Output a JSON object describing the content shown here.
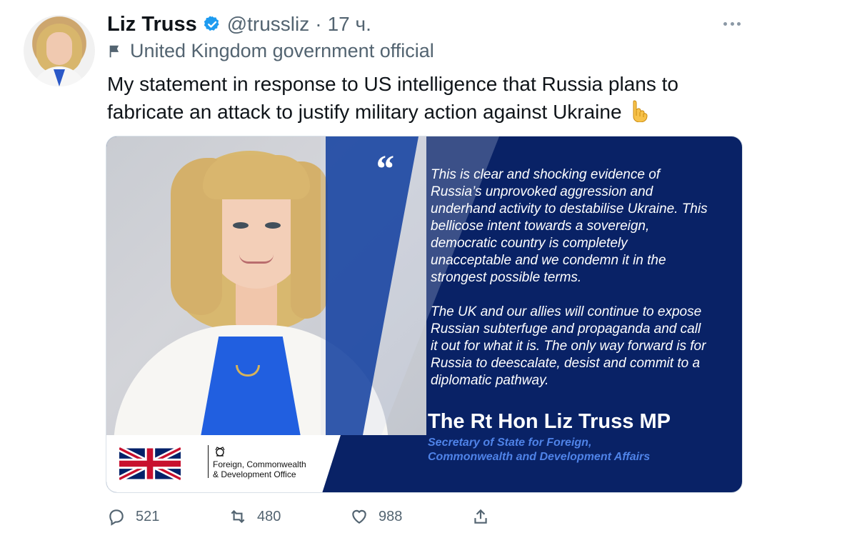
{
  "tweet": {
    "author_name": "Liz Truss",
    "handle": "@trussliz",
    "dot": "·",
    "time": "17 ч.",
    "label": "United Kingdom government official",
    "text_line_1": "My statement in response to US intelligence that Russia plans to",
    "text_line_2": "fabricate an attack to justify military action against Ukraine"
  },
  "media": {
    "quote_mark": "“",
    "quote_lines_1": [
      "This is clear and shocking evidence of",
      "Russia’s unprovoked aggression and",
      "underhand activity to destabilise Ukraine. This",
      "bellicose intent towards a sovereign,",
      "democratic country is completely",
      "unacceptable and we condemn it in the",
      "strongest possible terms."
    ],
    "quote_lines_2": [
      "The UK and our allies will continue to expose",
      "Russian subterfuge and propaganda and call",
      "it out for what it is. The only way forward is for",
      "Russia to deescalate, desist and commit to a",
      "diplomatic pathway."
    ],
    "signature_name": "The Rt Hon Liz Truss MP",
    "signature_title_1": "Secretary of State for Foreign,",
    "signature_title_2": "Commonwealth and Development Affairs",
    "fcdo_line_1": "Foreign, Commonwealth",
    "fcdo_line_2": "& Development Office"
  },
  "actions": {
    "replies": "521",
    "retweets": "480",
    "likes": "988"
  },
  "icons": {
    "verified": "verified-badge-icon",
    "label": "flag-icon",
    "more": "more-icon",
    "reply": "reply-icon",
    "retweet": "retweet-icon",
    "like": "heart-icon",
    "share": "share-icon"
  },
  "colors": {
    "verified": "#1d9bf0",
    "muted": "#536471",
    "media_blue": "#092266",
    "title_blue": "#4f83e8"
  }
}
